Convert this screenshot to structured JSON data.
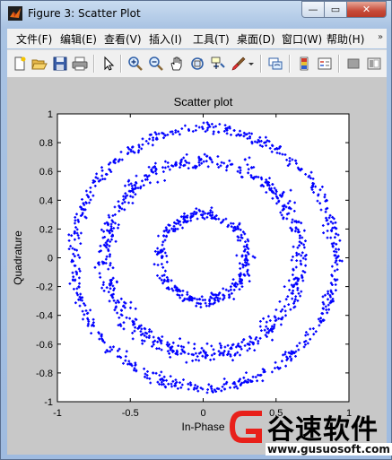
{
  "window": {
    "title": "Figure 3: Scatter Plot",
    "controls": {
      "minimize": "—",
      "maximize": "▭",
      "close": "✕"
    }
  },
  "menu": {
    "items": [
      "文件(F)",
      "编辑(E)",
      "查看(V)",
      "插入(I)",
      "工具(T)",
      "桌面(D)",
      "窗口(W)",
      "帮助(H)"
    ],
    "overflow": "»"
  },
  "toolbar": {
    "icons": [
      "new-figure-icon",
      "open-file-icon",
      "save-icon",
      "print-icon",
      "edit-plot-arrow-icon",
      "zoom-in-icon",
      "zoom-out-icon",
      "pan-hand-icon",
      "rotate-3d-icon",
      "data-cursor-icon",
      "brush-icon",
      "link-plot-icon",
      "insert-colorbar-icon",
      "insert-legend-icon",
      "hide-plot-tools-icon",
      "show-plot-tools-icon"
    ]
  },
  "watermark": {
    "text": "谷速软件",
    "url": "www.gusuosoft.com",
    "color": "#e8201a"
  },
  "chart_data": {
    "type": "scatter",
    "title": "Scatter plot",
    "xlabel": "In-Phase",
    "ylabel": "Quadrature",
    "xlim": [
      -1,
      1
    ],
    "ylim": [
      -1,
      1
    ],
    "xticks": [
      "-1",
      "-0.5",
      "0",
      "0.5",
      "1"
    ],
    "yticks": [
      "1",
      "0.8",
      "0.6",
      "0.4",
      "0.2",
      "0",
      "-0.2",
      "-0.4",
      "-0.6",
      "-0.8",
      "-1"
    ],
    "marker_color": "#0000ff",
    "marker": "dot",
    "rings": [
      {
        "center": [
          0,
          0
        ],
        "radius": 0.3,
        "noise": 0.02,
        "points": 320
      },
      {
        "center": [
          0,
          0
        ],
        "radius": 0.67,
        "noise": 0.03,
        "points": 640
      },
      {
        "center": [
          0.01,
          0
        ],
        "radius": 0.9,
        "noise": 0.02,
        "points": 600
      }
    ],
    "grid": false,
    "legend": "none"
  }
}
